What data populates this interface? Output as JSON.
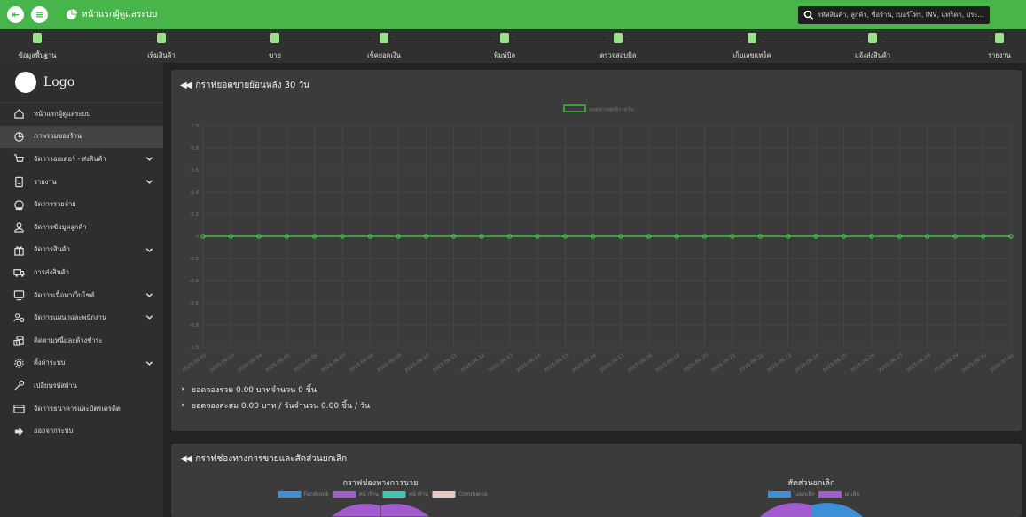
{
  "topbar": {
    "title": "หน้าแรกผู้ดูแลระบบ",
    "search_placeholder": "รหัสสินค้า, ลูกค้า, ชื่อร้าน, เบอร์โทร, INV, แทร็คก, ประ..."
  },
  "toolbar": [
    {
      "label": "ข้อมูลพื้นฐาน",
      "icon": "database-icon"
    },
    {
      "label": "เพิ่มสินค้า",
      "icon": "gift-icon"
    },
    {
      "label": "ขาย",
      "icon": "cart-icon"
    },
    {
      "label": "เช็คยอดเงิน",
      "icon": "clipboard-check-icon"
    },
    {
      "label": "พิมพ์บิล",
      "icon": "printer-icon"
    },
    {
      "label": "ตรวจสอบบิล",
      "icon": "invoice-icon"
    },
    {
      "label": "เก็บเลขแทร็ค",
      "icon": "barcode-icon"
    },
    {
      "label": "แจ้งส่งสินค้า",
      "icon": "truck-icon"
    },
    {
      "label": "รายงาน",
      "icon": "report-icon"
    }
  ],
  "sidebar": {
    "logo_text": "Logo",
    "items": [
      {
        "label": "หน้าแรกผู้ดูแลระบบ",
        "icon": "home-icon",
        "expandable": false,
        "active": false
      },
      {
        "label": "ภาพรวมของร้าน",
        "icon": "pie-chart-icon",
        "expandable": false,
        "active": true
      },
      {
        "label": "จัดการออเดอร์ - ส่งสินค้า",
        "icon": "cart-icon",
        "expandable": true,
        "active": false
      },
      {
        "label": "รายงาน",
        "icon": "document-icon",
        "expandable": true,
        "active": false
      },
      {
        "label": "จัดการรายจ่าย",
        "icon": "money-icon",
        "expandable": false,
        "active": false
      },
      {
        "label": "จัดการข้อมูลลูกค้า",
        "icon": "user-icon",
        "expandable": false,
        "active": false
      },
      {
        "label": "จัดการสินค้า",
        "icon": "gift-icon",
        "expandable": true,
        "active": false
      },
      {
        "label": "การส่งสินค้า",
        "icon": "truck-icon",
        "expandable": false,
        "active": false
      },
      {
        "label": "จัดการเนื้อหาเว็บไซต์",
        "icon": "monitor-icon",
        "expandable": true,
        "active": false
      },
      {
        "label": "จัดการแผนกและพนักงาน",
        "icon": "team-icon",
        "expandable": true,
        "active": false
      },
      {
        "label": "ติดตามหนี้และค้างชำระ",
        "icon": "coins-icon",
        "expandable": false,
        "active": false
      },
      {
        "label": "ตั้งค่าระบบ",
        "icon": "gear-icon",
        "expandable": true,
        "active": false
      },
      {
        "label": "เปลี่ยนรหัสผ่าน",
        "icon": "key-icon",
        "expandable": false,
        "active": false
      },
      {
        "label": "จัดการธนาคารและบัตรเครดิต",
        "icon": "bank-card-icon",
        "expandable": false,
        "active": false
      },
      {
        "label": "ออกจากระบบ",
        "icon": "logout-icon",
        "expandable": false,
        "active": false
      }
    ]
  },
  "panel_sales": {
    "title": "กราฟยอดขายย้อนหลัง 30 วัน",
    "summary_total": "ยอดจองรวม 0.00 บาทจำนวน 0 ชิ้น",
    "summary_avg": "ยอดจองสะสม 0.00 บาท / วันจำนวน 0.00 ชิ้น / วัน"
  },
  "panel_channels": {
    "title": "กราฟช่องทางการขายและสัดส่วนยกเลิก",
    "chart_left_title": "กราฟช่องทางการขาย",
    "chart_right_title": "สัดส่วนยกเลิก"
  },
  "colors": {
    "topbar": "#48b54a",
    "line": "#3fbf3f",
    "facebook": "#3d8fd6",
    "purple": "#a35bd0",
    "teal": "#3cc6b4",
    "pink": "#e9c8c0"
  },
  "chart_data": [
    {
      "type": "line",
      "legend": [
        "ยอดขายสุทธิรายวัน"
      ],
      "x": [
        "2025-06-02",
        "2025-06-03",
        "2025-06-04",
        "2025-06-05",
        "2025-06-06",
        "2025-06-07",
        "2025-06-08",
        "2025-06-09",
        "2025-06-10",
        "2025-06-11",
        "2025-06-12",
        "2025-06-13",
        "2025-06-14",
        "2025-06-15",
        "2025-06-16",
        "2025-06-17",
        "2025-06-18",
        "2025-06-19",
        "2025-06-20",
        "2025-06-21",
        "2025-06-22",
        "2025-06-23",
        "2025-06-24",
        "2025-06-25",
        "2025-06-26",
        "2025-06-27",
        "2025-06-28",
        "2025-06-29",
        "2025-06-30",
        "2025-07-01"
      ],
      "series": [
        {
          "name": "ยอดขายสุทธิรายวัน",
          "values": [
            0,
            0,
            0,
            0,
            0,
            0,
            0,
            0,
            0,
            0,
            0,
            0,
            0,
            0,
            0,
            0,
            0,
            0,
            0,
            0,
            0,
            0,
            0,
            0,
            0,
            0,
            0,
            0,
            0,
            0
          ]
        }
      ],
      "ylim": [
        -1,
        1
      ],
      "yticks": [
        "1.0",
        "0.8",
        "0.6",
        "0.4",
        "0.2",
        "0",
        "-0.2",
        "-0.4",
        "-0.6",
        "-0.8",
        "-1.0"
      ],
      "grid": true,
      "legend_position": "top-center"
    },
    {
      "type": "pie",
      "title": "กราฟช่องทางการขาย",
      "legend": [
        "Facebook",
        "หน้าร้าน",
        "หน้าร้าน",
        "Commerce"
      ]
    },
    {
      "type": "pie",
      "title": "สัดส่วนยกเลิก",
      "legend": [
        "ไม่ยกเลิก",
        "ยกเลิก"
      ]
    }
  ]
}
